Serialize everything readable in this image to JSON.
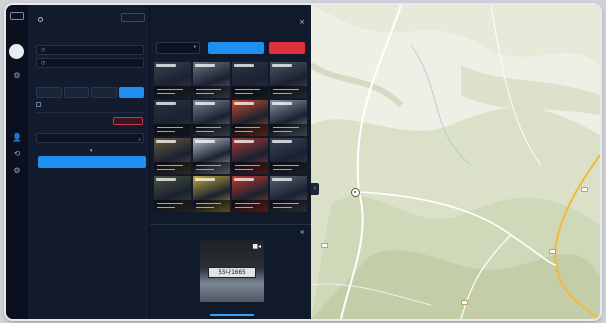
{
  "filter_panel": {
    "title": "",
    "reset_label": "",
    "period_label": "",
    "date_start": "",
    "date_end": "",
    "object_label": "",
    "segments": [
      {
        "label": "",
        "active": false
      },
      {
        "label": "",
        "active": false
      },
      {
        "label": "",
        "active": false
      },
      {
        "label": "",
        "active": true
      }
    ],
    "checkbox_label": "",
    "camera_label": "",
    "camera_tag": "",
    "search_placeholder": "",
    "search_button": ""
  },
  "results_panel": {
    "title": "",
    "tabs": [
      "",
      ""
    ],
    "sort_select": "",
    "blue_button": "",
    "red_button": "",
    "thumbnails": [
      {
        "tone": "#3a4352"
      },
      {
        "tone": "#6b7382"
      },
      {
        "tone": "#2d3645"
      },
      {
        "tone": "#4d5564"
      },
      {
        "tone": "#2a3240"
      },
      {
        "tone": "#7a8190"
      },
      {
        "tone": "#c94b2e"
      },
      {
        "tone": "#8b94a3"
      },
      {
        "tone": "#6e5a3c"
      },
      {
        "tone": "#b8c0cc"
      },
      {
        "tone": "#aa3a36"
      },
      {
        "tone": "#3a4656"
      },
      {
        "tone": "#4a5240"
      },
      {
        "tone": "#c7a93a"
      },
      {
        "tone": "#c23b2b"
      },
      {
        "tone": "#5c6470"
      }
    ]
  },
  "detail_panel": {
    "title": "",
    "plate_text": "55나1665",
    "caption": ""
  },
  "map": {
    "pin_label": "",
    "labels": [],
    "accent_road": "#f3b93b"
  },
  "colors": {
    "accent": "#1f8ff0",
    "danger": "#e0313f",
    "panel": "#131c2e"
  }
}
